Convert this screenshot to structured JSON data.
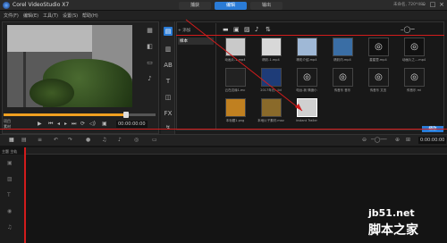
{
  "app": {
    "title": "Corel VideoStudio X7"
  },
  "window_controls": [
    "–",
    "□",
    "×"
  ],
  "menu": [
    "文件(F)",
    "编辑(E)",
    "工具(T)",
    "设置(S)",
    "帮助(H)"
  ],
  "step_tabs": [
    {
      "label": "捕获",
      "active": false
    },
    {
      "label": "编辑",
      "active": true
    },
    {
      "label": "输出",
      "active": false
    }
  ],
  "project_info": "未命名, 720*480",
  "library": {
    "add_label": "+ 添加",
    "folder": "样本",
    "items": [
      {
        "label": "动画片-1.mp4"
      },
      {
        "label": "精彩-1.mp4"
      },
      {
        "label": "精彩介绍.mp4"
      },
      {
        "label": "精彩内.mp4"
      },
      {
        "label": "星星里.mp4"
      },
      {
        "label": "动画片之....mp4"
      },
      {
        "label": "云在边缘1.mc"
      },
      {
        "label": "2017年元...lid"
      },
      {
        "label": "电台-我 情绪小"
      },
      {
        "label": "传音乐 音乐"
      },
      {
        "label": "传音乐 文言"
      },
      {
        "label": "传音乐 mi"
      },
      {
        "label": "本标题1.png"
      },
      {
        "label": "本地片子素材.mov"
      },
      {
        "label": "instant Trailer"
      }
    ],
    "play_button": "播放"
  },
  "player": {
    "project_label": "项目",
    "clip_label": "素材",
    "timecode": "00:00:00:00"
  },
  "timeline": {
    "timecode": "0:00:00:00",
    "track_label": "主题 主轨"
  },
  "watermark": {
    "line1": "jb51.net",
    "line2": "脚本之家"
  },
  "colors": {
    "accent": "#2a7bd6",
    "annotation": "#d21c1c"
  }
}
